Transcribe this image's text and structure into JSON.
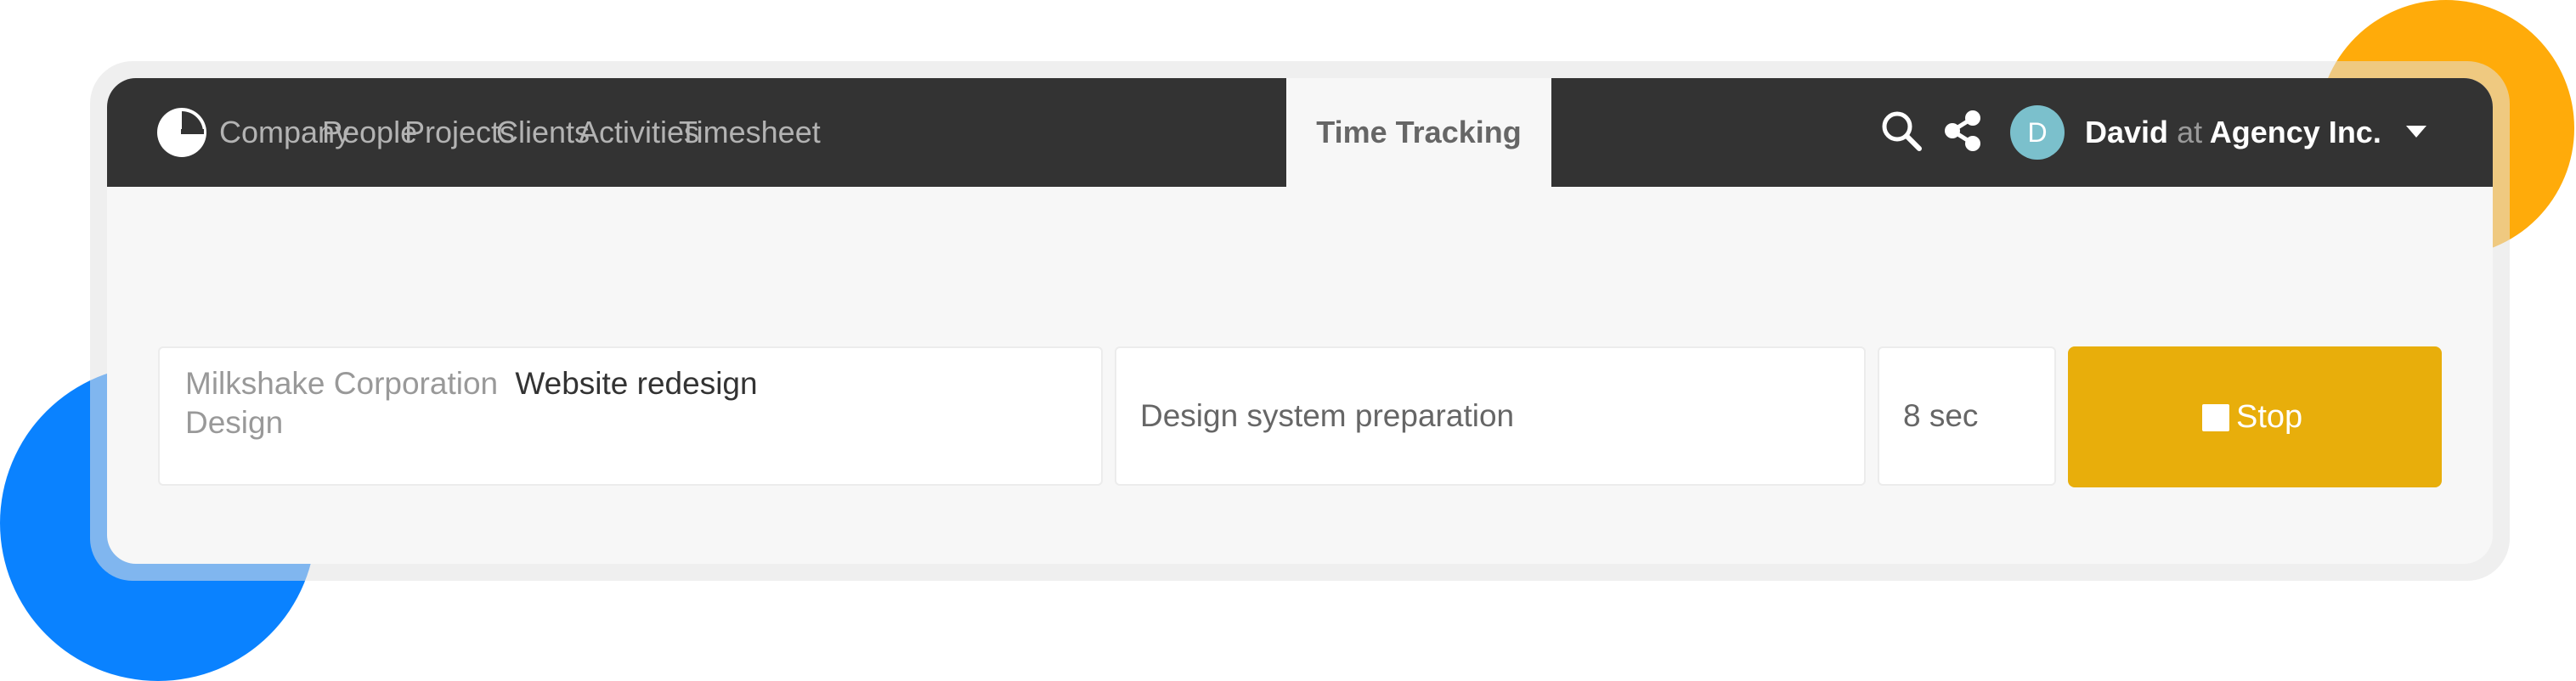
{
  "nav": {
    "company": "Company",
    "people": "People",
    "projects": "Projects",
    "clients": "Clients",
    "activities": "Activities",
    "timesheet": "Timesheet",
    "time_tracking": "Time Tracking"
  },
  "user": {
    "avatar_initial": "D",
    "name": "David",
    "at": "at",
    "org": "Agency Inc."
  },
  "tracker": {
    "client": "Milkshake Corporation",
    "project": "Website redesign",
    "activity": "Design",
    "task": "Design system preparation",
    "elapsed": "8 sec",
    "stop_label": "Stop"
  },
  "colors": {
    "navbar": "#333333",
    "stop_button": "#E8AE0B",
    "avatar": "#7BC0CC",
    "accent_orange": "#FFAB0A",
    "accent_blue": "#0A82FF"
  },
  "icons": [
    "company-logo-icon",
    "search-icon",
    "share-icon",
    "caret-down-icon",
    "stop-icon"
  ]
}
